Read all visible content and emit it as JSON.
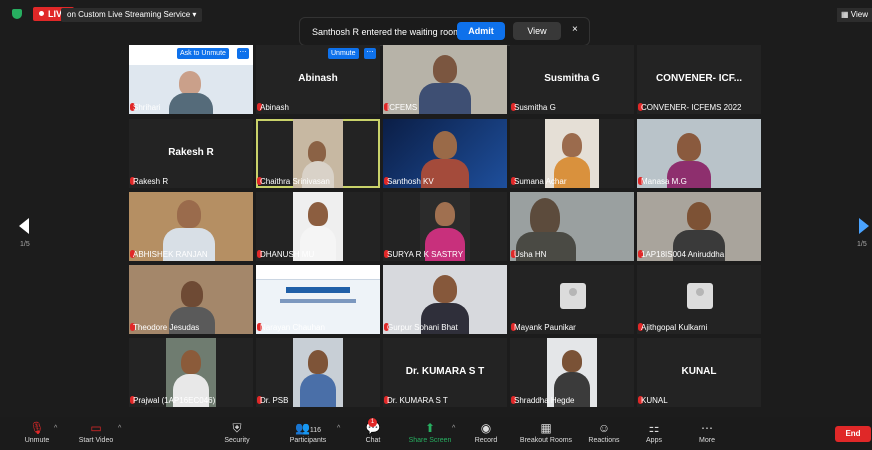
{
  "top": {
    "live": "LIVE",
    "stream": "on Custom Live Streaming Service",
    "view": "View"
  },
  "waiting": {
    "message": "Santhosh R entered the waiting room",
    "admit": "Admit",
    "view": "View",
    "close": "×"
  },
  "pager": {
    "left": "1/5",
    "right": "1/5"
  },
  "hover": {
    "ask": "Ask to Unmute",
    "unmute": "Unmute",
    "more": "⋯"
  },
  "tiles": [
    {
      "name": "Shrihari",
      "big": ""
    },
    {
      "name": "Abinash",
      "big": "Abinash"
    },
    {
      "name": "ICFEMS",
      "big": ""
    },
    {
      "name": "Susmitha G",
      "big": "Susmitha G"
    },
    {
      "name": "CONVENER- ICFEMS 2022",
      "big": "CONVENER- ICF..."
    },
    {
      "name": "Rakesh R",
      "big": "Rakesh R"
    },
    {
      "name": "Chaithra Srinivasan",
      "big": ""
    },
    {
      "name": "Santhosh KV",
      "big": ""
    },
    {
      "name": "Sumana Achar",
      "big": ""
    },
    {
      "name": "Manasa M.G",
      "big": ""
    },
    {
      "name": "ABHISHEK RANJAN",
      "big": ""
    },
    {
      "name": "DHANUSH MU",
      "big": ""
    },
    {
      "name": "SURYA R K SASTRY",
      "big": ""
    },
    {
      "name": "Usha HN",
      "big": ""
    },
    {
      "name": "1AP18IS004 Aniruddha",
      "big": ""
    },
    {
      "name": "Theodore Jesudas",
      "big": ""
    },
    {
      "name": "Narayan Chauhan",
      "big": ""
    },
    {
      "name": "Gurpur Sohani Bhat",
      "big": ""
    },
    {
      "name": "Mayank Paunikar",
      "big": ""
    },
    {
      "name": "Ajithgopal Kulkarni",
      "big": ""
    },
    {
      "name": "Prajwal (1AP16EC046)",
      "big": ""
    },
    {
      "name": "Dr. PSB",
      "big": ""
    },
    {
      "name": "Dr. KUMARA S T",
      "big": "Dr. KUMARA S T"
    },
    {
      "name": "Shraddha Hegde",
      "big": ""
    },
    {
      "name": "KUNAL",
      "big": "KUNAL"
    }
  ],
  "toolbar": {
    "unmute": "Unmute",
    "start_video": "Start Video",
    "security": "Security",
    "participants": "Participants",
    "participant_count": "116",
    "chat": "Chat",
    "chat_badge": "1",
    "share": "Share Screen",
    "record": "Record",
    "breakout": "Breakout Rooms",
    "reactions": "Reactions",
    "apps": "Apps",
    "more": "More",
    "end": "End"
  },
  "colors": {
    "accent": "#0e71eb",
    "share": "#27ae60",
    "end": "#e02828",
    "active": "#c9d26a"
  }
}
